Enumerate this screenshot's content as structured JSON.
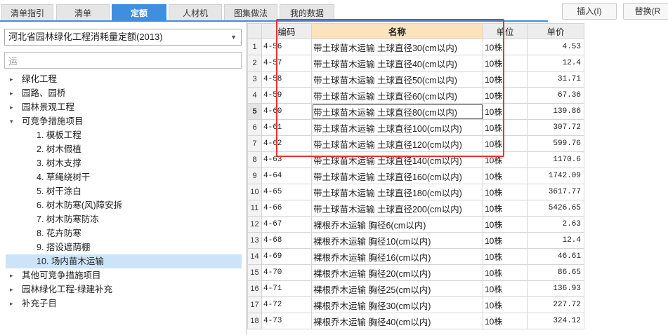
{
  "tabs": [
    {
      "label": "清单指引",
      "active": false
    },
    {
      "label": "清单",
      "active": false
    },
    {
      "label": "定额",
      "active": true
    },
    {
      "label": "人材机",
      "active": false
    },
    {
      "label": "图集做法",
      "active": false
    },
    {
      "label": "我的数据",
      "active": false
    }
  ],
  "toolbar": {
    "insert_label": "插入(I)",
    "replace_label": "替换(R"
  },
  "left": {
    "dropdown_value": "河北省园林绿化工程消耗量定额(2013)",
    "search_value": "运",
    "tree": [
      {
        "label": "绿化工程",
        "caret": "▸",
        "child": false,
        "selected": false
      },
      {
        "label": "园路、园桥",
        "caret": "▸",
        "child": false,
        "selected": false
      },
      {
        "label": "园林景观工程",
        "caret": "▸",
        "child": false,
        "selected": false
      },
      {
        "label": "可竞争措施项目",
        "caret": "▾",
        "child": false,
        "selected": false
      },
      {
        "label": "1. 模板工程",
        "caret": "",
        "child": true,
        "selected": false
      },
      {
        "label": "2. 树木假植",
        "caret": "",
        "child": true,
        "selected": false
      },
      {
        "label": "3. 树木支撑",
        "caret": "",
        "child": true,
        "selected": false
      },
      {
        "label": "4. 草绳绕树干",
        "caret": "",
        "child": true,
        "selected": false
      },
      {
        "label": "5. 树干涂白",
        "caret": "",
        "child": true,
        "selected": false
      },
      {
        "label": "6. 树木防寒(风)障安拆",
        "caret": "",
        "child": true,
        "selected": false
      },
      {
        "label": "7. 树木防寒防冻",
        "caret": "",
        "child": true,
        "selected": false
      },
      {
        "label": "8. 花卉防寒",
        "caret": "",
        "child": true,
        "selected": false
      },
      {
        "label": "9. 搭设遮荫棚",
        "caret": "",
        "child": true,
        "selected": false
      },
      {
        "label": "10. 场内苗木运输",
        "caret": "",
        "child": true,
        "selected": true
      },
      {
        "label": "其他可竞争措施项目",
        "caret": "▸",
        "child": false,
        "selected": false
      },
      {
        "label": "园林绿化工程-绿建补充",
        "caret": "▸",
        "child": false,
        "selected": false
      },
      {
        "label": "补充子目",
        "caret": "▸",
        "child": false,
        "selected": false
      }
    ]
  },
  "grid": {
    "headers": {
      "rownum": "",
      "code": "编码",
      "name": "名称",
      "unit": "单位",
      "price": "单价"
    },
    "current_row": 5,
    "rows": [
      {
        "n": "1",
        "code": "4-56",
        "name": "带土球苗木运输 土球直径30(cm以内)",
        "unit": "10株",
        "price": "4.53"
      },
      {
        "n": "2",
        "code": "4-57",
        "name": "带土球苗木运输 土球直径40(cm以内)",
        "unit": "10株",
        "price": "12.4"
      },
      {
        "n": "3",
        "code": "4-58",
        "name": "带土球苗木运输 土球直径50(cm以内)",
        "unit": "10株",
        "price": "31.71"
      },
      {
        "n": "4",
        "code": "4-59",
        "name": "带土球苗木运输 土球直径60(cm以内)",
        "unit": "10株",
        "price": "67.36"
      },
      {
        "n": "5",
        "code": "4-60",
        "name": "带土球苗木运输 土球直径80(cm以内)",
        "unit": "10株",
        "price": "139.86"
      },
      {
        "n": "6",
        "code": "4-61",
        "name": "带土球苗木运输 土球直径100(cm以内)",
        "unit": "10株",
        "price": "307.72"
      },
      {
        "n": "7",
        "code": "4-62",
        "name": "带土球苗木运输 土球直径120(cm以内)",
        "unit": "10株",
        "price": "599.76"
      },
      {
        "n": "8",
        "code": "4-63",
        "name": "带土球苗木运输 土球直径140(cm以内)",
        "unit": "10株",
        "price": "1170.6"
      },
      {
        "n": "9",
        "code": "4-64",
        "name": "带土球苗木运输 土球直径160(cm以内)",
        "unit": "10株",
        "price": "1742.09"
      },
      {
        "n": "10",
        "code": "4-65",
        "name": "带土球苗木运输 土球直径180(cm以内)",
        "unit": "10株",
        "price": "3617.77"
      },
      {
        "n": "11",
        "code": "4-66",
        "name": "带土球苗木运输 土球直径200(cm以内)",
        "unit": "10株",
        "price": "5426.65"
      },
      {
        "n": "12",
        "code": "4-67",
        "name": "裸根乔木运输 胸径6(cm以内)",
        "unit": "10株",
        "price": "2.63"
      },
      {
        "n": "13",
        "code": "4-68",
        "name": "裸根乔木运输 胸径10(cm以内)",
        "unit": "10株",
        "price": "12.4"
      },
      {
        "n": "14",
        "code": "4-69",
        "name": "裸根乔木运输 胸径16(cm以内)",
        "unit": "10株",
        "price": "46.61"
      },
      {
        "n": "15",
        "code": "4-70",
        "name": "裸根乔木运输 胸径20(cm以内)",
        "unit": "10株",
        "price": "86.65"
      },
      {
        "n": "16",
        "code": "4-71",
        "name": "裸根乔木运输 胸径25(cm以内)",
        "unit": "10株",
        "price": "136.93"
      },
      {
        "n": "17",
        "code": "4-72",
        "name": "裸根乔木运输 胸径30(cm以内)",
        "unit": "10株",
        "price": "227.72"
      },
      {
        "n": "18",
        "code": "4-73",
        "name": "裸根乔木运输 胸径40(cm以内)",
        "unit": "10株",
        "price": "324.12"
      }
    ]
  },
  "colors": {
    "accent": "#3e8fe0",
    "highlight_header": "#fbe3bd",
    "annotation": "#e8332a",
    "selected_row": "#cce4f7"
  }
}
